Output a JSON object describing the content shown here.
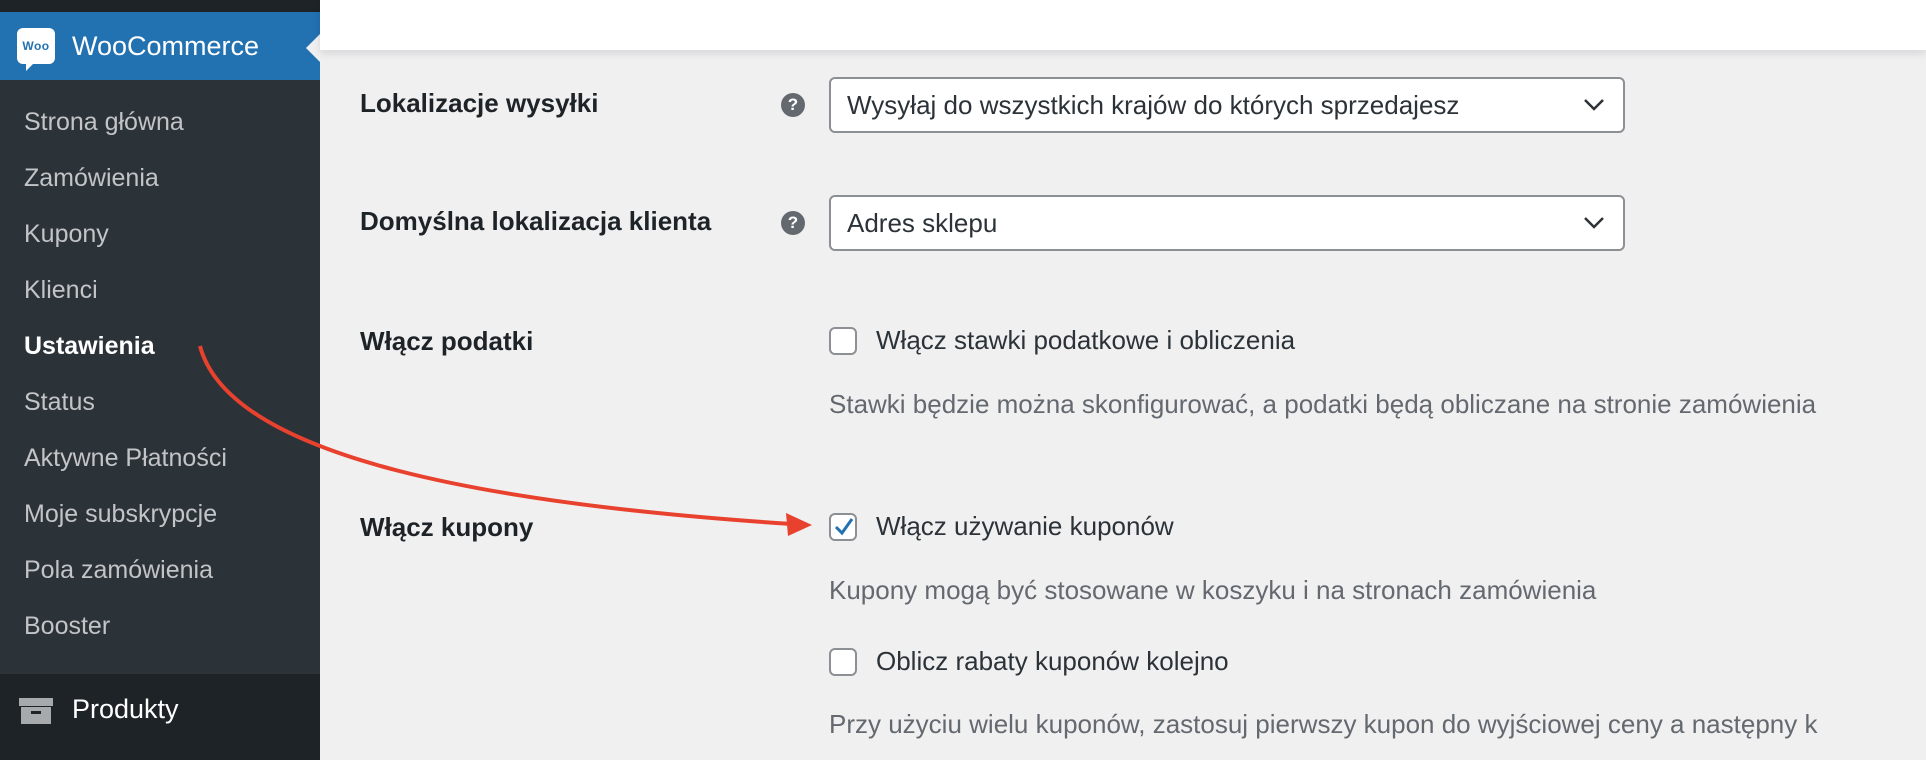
{
  "sidebar": {
    "brand": {
      "logo_text": "Woo",
      "title": "WooCommerce"
    },
    "items": [
      {
        "label": "Strona główna"
      },
      {
        "label": "Zamówienia"
      },
      {
        "label": "Kupony"
      },
      {
        "label": "Klienci"
      },
      {
        "label": "Ustawienia",
        "active": true
      },
      {
        "label": "Status"
      },
      {
        "label": "Aktywne Płatności"
      },
      {
        "label": "Moje subskrypcje"
      },
      {
        "label": "Pola zamówienia"
      },
      {
        "label": "Booster"
      }
    ],
    "section": {
      "label": "Produkty",
      "icon": "archive-box-icon"
    }
  },
  "settings": {
    "shipping_locations": {
      "label": "Lokalizacje wysyłki",
      "value": "Wysyłaj do wszystkich krajów do których sprzedajesz"
    },
    "default_customer_location": {
      "label": "Domyślna lokalizacja klienta",
      "value": "Adres sklepu"
    },
    "enable_taxes": {
      "label": "Włącz podatki",
      "checkbox_label": "Włącz stawki podatkowe i obliczenia",
      "checked": false,
      "description": "Stawki będzie można skonfigurować, a podatki będą obliczane na stronie zamówienia"
    },
    "enable_coupons": {
      "label": "Włącz kupony",
      "checkbox_label": "Włącz używanie kuponów",
      "checked": true,
      "description": "Kupony mogą być stosowane w koszyku i na stronach zamówienia",
      "sequential_label": "Oblicz rabaty kuponów kolejno",
      "sequential_checked": false,
      "sequential_description": "Przy użyciu wielu kuponów, zastosuj pierwszy kupon do wyjściowej ceny a następny k"
    }
  },
  "colors": {
    "sidebar_bg": "#2c3338",
    "brand_blue": "#2271b1",
    "annotation_arrow": "#e8412e",
    "page_bg": "#f0f0f1"
  }
}
